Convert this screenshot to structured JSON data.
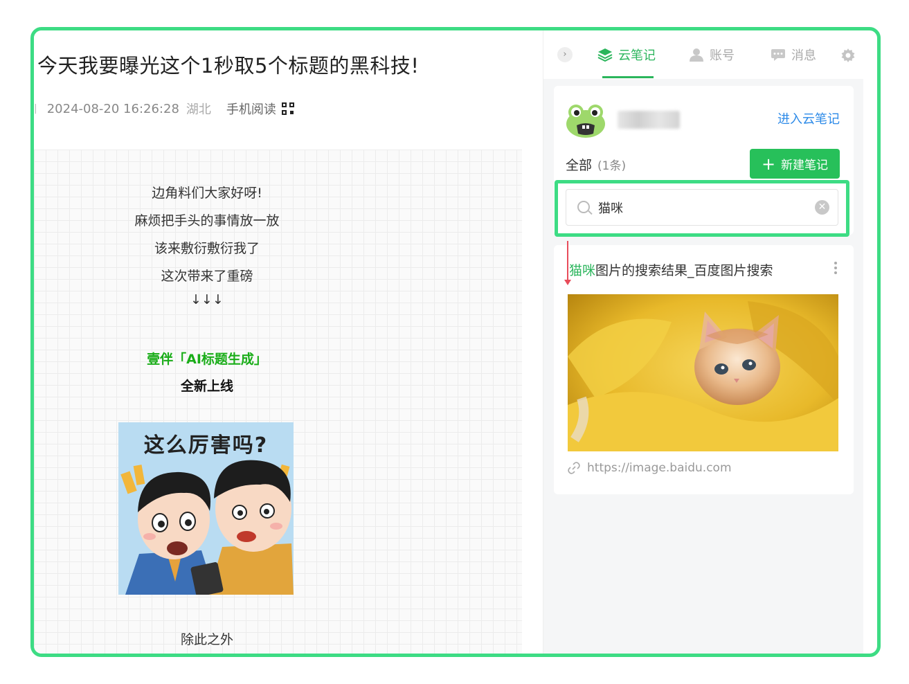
{
  "article": {
    "title": "今天我要曝光这个1秒取5个标题的黑科技!",
    "meta": {
      "date": "2024-08-20 16:26:28",
      "location": "湖北",
      "mobile_read": "手机阅读"
    },
    "lines": [
      "边角料们大家好呀!",
      "麻烦把手头的事情放一放",
      "该来敷衍敷衍我了",
      "这次带来了重磅",
      "↓↓↓"
    ],
    "green_title": "壹伴「AI标题生成」",
    "bold_line": "全新上线",
    "comic_text": "这么厉害吗?",
    "last_line": "除此之外"
  },
  "panel": {
    "tabs": [
      {
        "label": "云笔记",
        "icon": "layers-icon",
        "active": true
      },
      {
        "label": "账号",
        "icon": "user-icon",
        "active": false
      },
      {
        "label": "消息",
        "icon": "chat-icon",
        "active": false
      }
    ],
    "enter_link": "进入云笔记",
    "filter_label": "全部",
    "filter_count": "(1条)",
    "new_note_label": "新建笔记",
    "search": {
      "value": "猫咪"
    },
    "result": {
      "title_highlight": "猫咪",
      "title_rest": "图片的搜索结果_百度图片搜索",
      "link": "https://image.baidu.com"
    },
    "colors": {
      "accent": "#2bb55c",
      "highlight_border": "#3ddc84",
      "button": "#27c05a",
      "link": "#2c8ae8"
    }
  }
}
